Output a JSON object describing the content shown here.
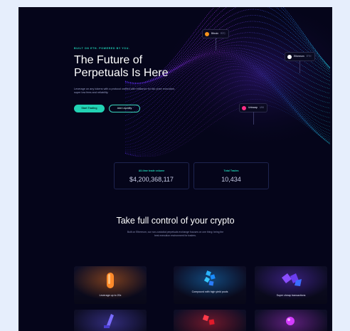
{
  "hero": {
    "eyebrow": "BUILT ON ETH. POWERED BY YOU.",
    "title_line1": "The Future of",
    "title_line2": "Perpetuals Is Here",
    "subtitle": "Leverage on any tokens with a protocol crafted with brilliance for fair price execution, super low fees and reliability.",
    "primary_button": "Start Trading",
    "secondary_button": "Add Liquidity"
  },
  "price_pills": [
    {
      "name": "Bitcoin",
      "symbol": "BTC",
      "color": "#f7931a"
    },
    {
      "name": "Ethereum",
      "symbol": "ETH",
      "color": "#ffffff"
    },
    {
      "name": "Uniswap",
      "symbol": "UNI",
      "color": "#ff2d87"
    }
  ],
  "stats": [
    {
      "label": "All-time trade volume",
      "value": "$4,200,368,117"
    },
    {
      "label": "Total Trades",
      "value": "10,434"
    }
  ],
  "features": {
    "title": "Take full control of your crypto",
    "subtitle": "Built on Ethereum, our non-custodial perpetuals exchange focuses on one thing: being the best execution environment for traders.",
    "cards": [
      {
        "label": "Leverage up to 20x",
        "icon": "orange-capsule-icon",
        "color": "#ff7a1a"
      },
      {
        "label": "Compound with high yield pools",
        "icon": "blue-cubes-icon",
        "color": "#1aa0ff"
      },
      {
        "label": "Super cheap transactions",
        "icon": "purple-gems-icon",
        "color": "#7a3dff"
      },
      {
        "label": "",
        "icon": "violet-crystal-icon",
        "color": "#6a5cff"
      },
      {
        "label": "",
        "icon": "red-blocks-icon",
        "color": "#ff2a3a"
      },
      {
        "label": "",
        "icon": "magenta-orb-icon",
        "color": "#d43cff"
      }
    ]
  }
}
